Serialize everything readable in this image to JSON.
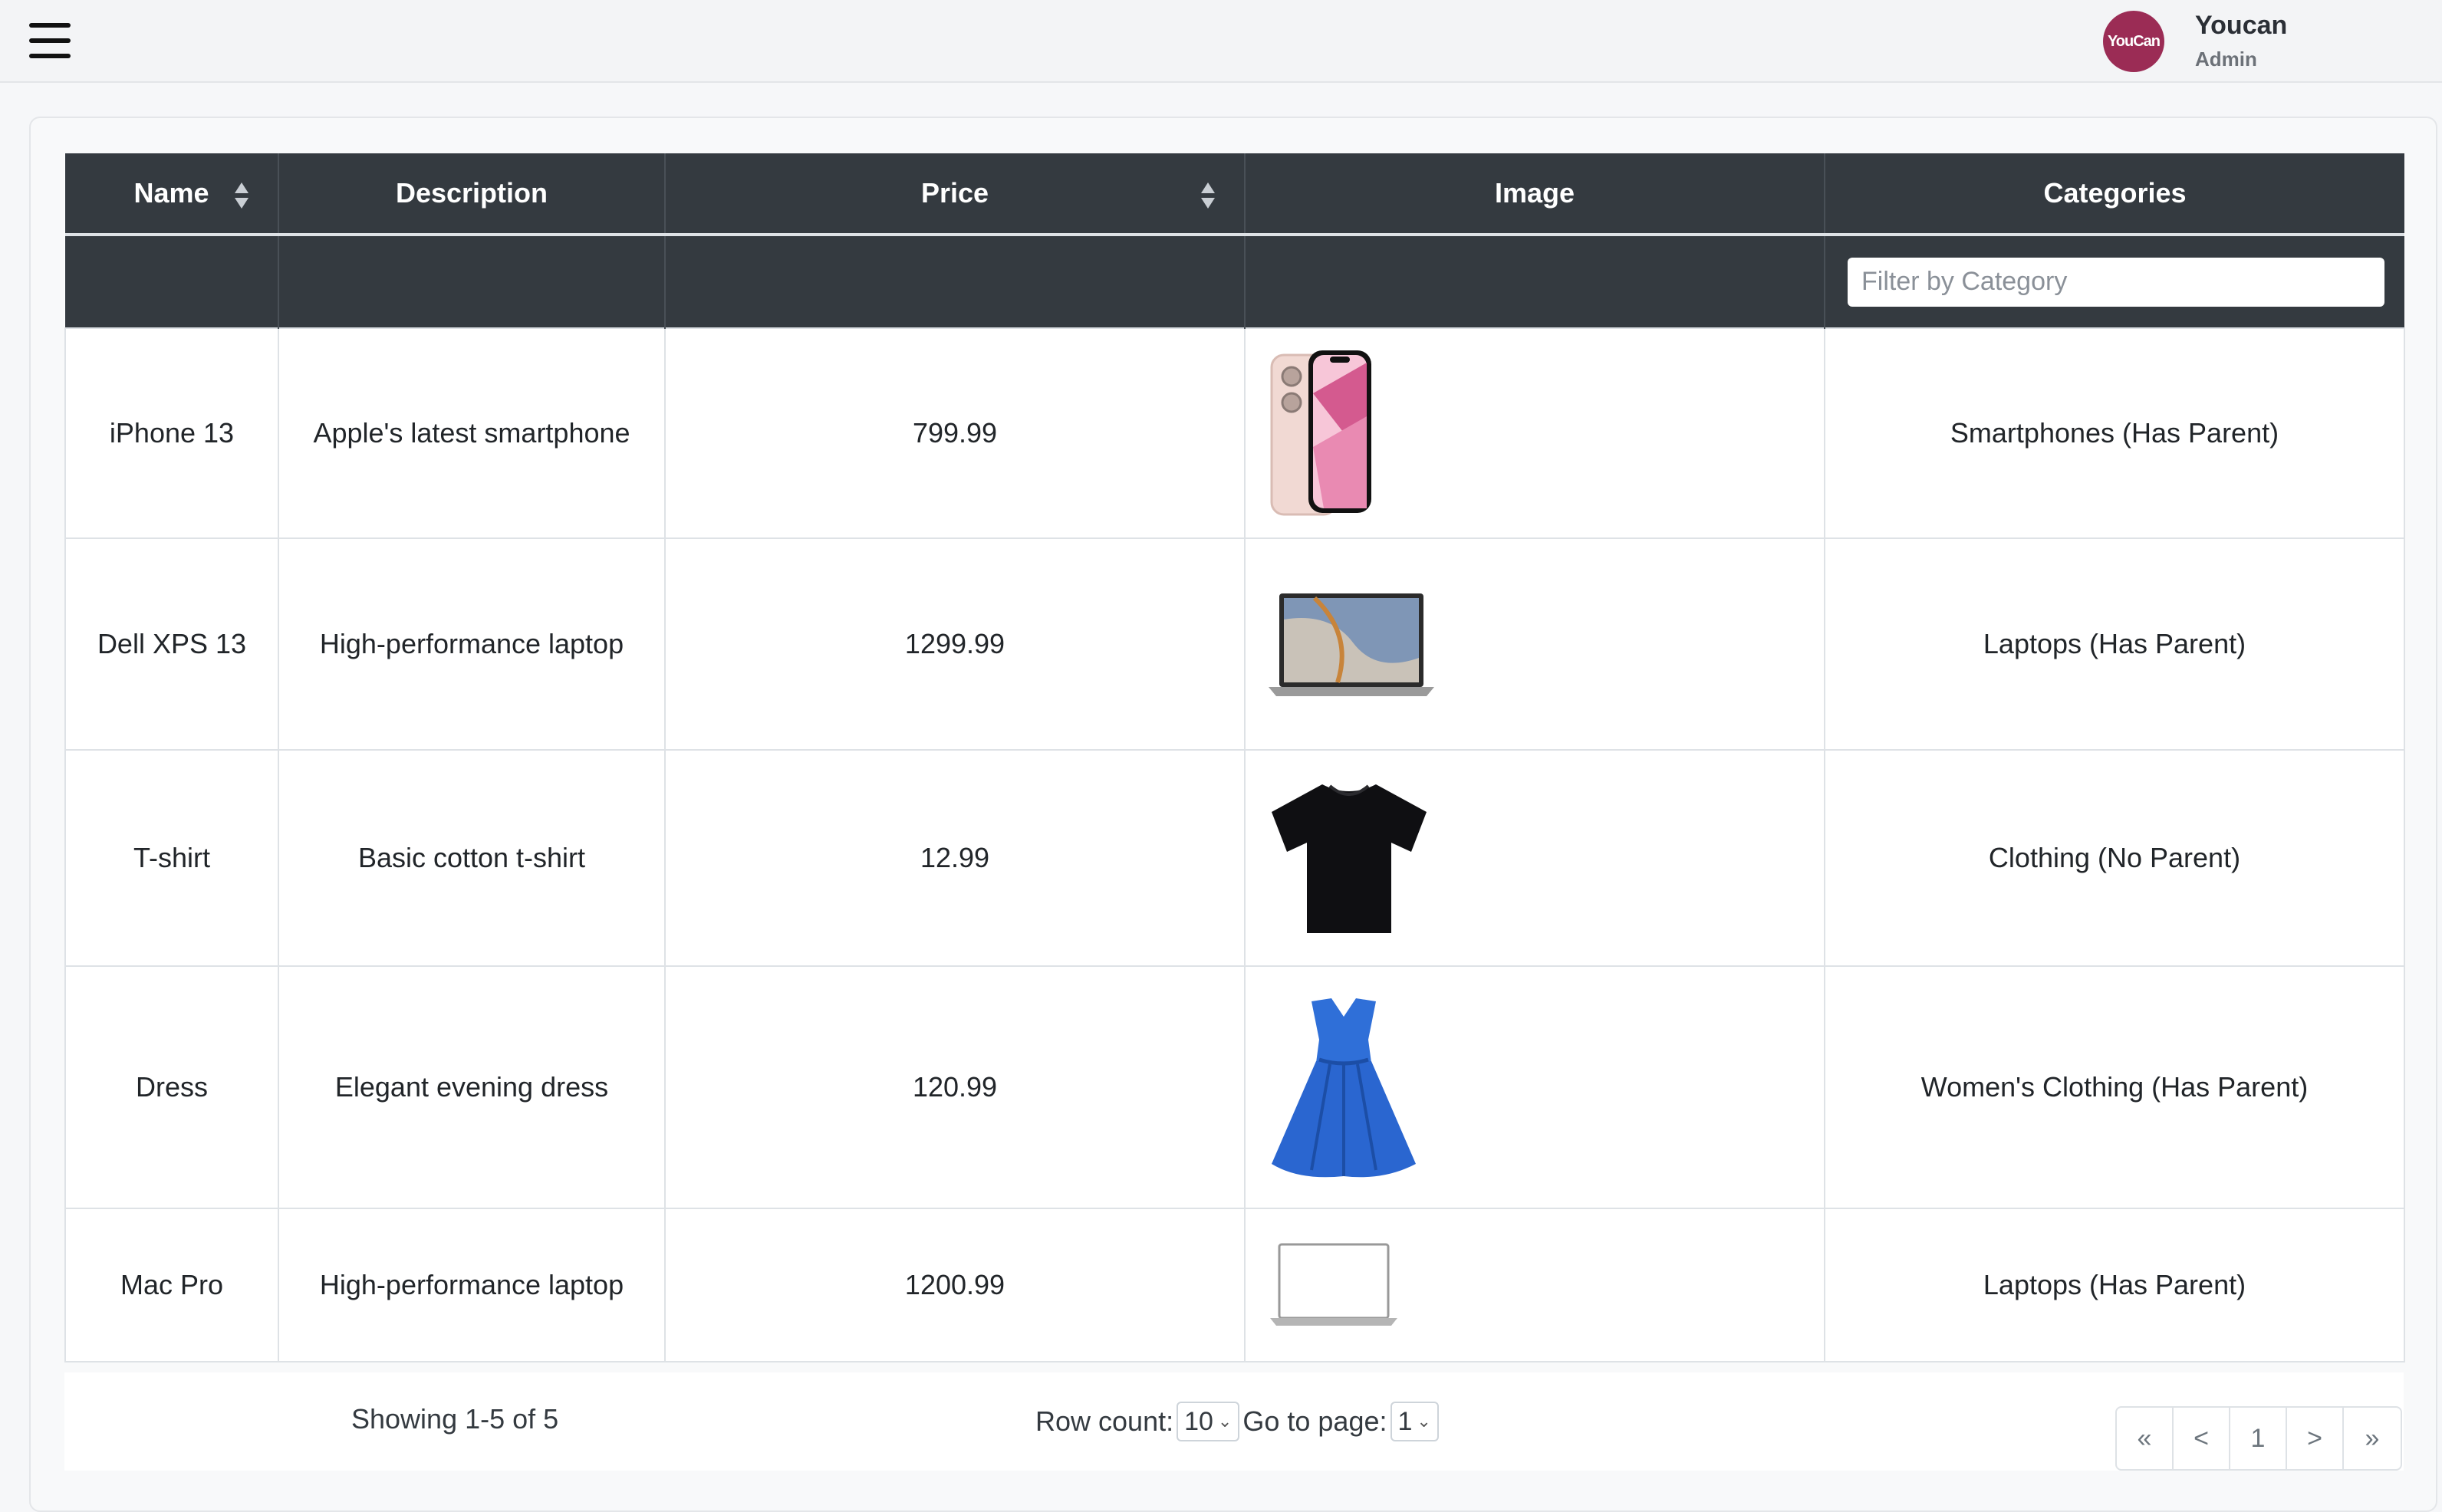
{
  "header": {
    "avatar_text": "YouCan",
    "avatar_color": "#9b2c55",
    "user_name": "Youcan",
    "user_role": "Admin"
  },
  "table": {
    "columns": [
      {
        "label": "Name",
        "sortable": true
      },
      {
        "label": "Description",
        "sortable": false
      },
      {
        "label": "Price",
        "sortable": true
      },
      {
        "label": "Image",
        "sortable": false
      },
      {
        "label": "Categories",
        "sortable": false
      }
    ],
    "filter_placeholder": "Filter by Category",
    "rows": [
      {
        "name": "iPhone 13",
        "description": "Apple's latest smartphone",
        "price": "799.99",
        "image": "iphone-image",
        "category": "Smartphones (Has Parent)"
      },
      {
        "name": "Dell XPS 13",
        "description": "High-performance laptop",
        "price": "1299.99",
        "image": "laptop-image",
        "category": "Laptops (Has Parent)"
      },
      {
        "name": "T-shirt",
        "description": "Basic cotton t-shirt",
        "price": "12.99",
        "image": "tshirt-image",
        "category": "Clothing (No Parent)"
      },
      {
        "name": "Dress",
        "description": "Elegant evening dress",
        "price": "120.99",
        "image": "dress-image",
        "category": "Women's Clothing (Has Parent)"
      },
      {
        "name": "Mac Pro",
        "description": "High-performance laptop",
        "price": "1200.99",
        "image": "macbook-image",
        "category": "Laptops (Has Parent)"
      }
    ]
  },
  "footer": {
    "showing": "Showing 1-5 of 5",
    "row_count_label": "Row count:",
    "row_count_value": "10",
    "goto_label": "Go to page:",
    "goto_value": "1",
    "pager": [
      "«",
      "<",
      "1",
      ">",
      "»"
    ]
  }
}
